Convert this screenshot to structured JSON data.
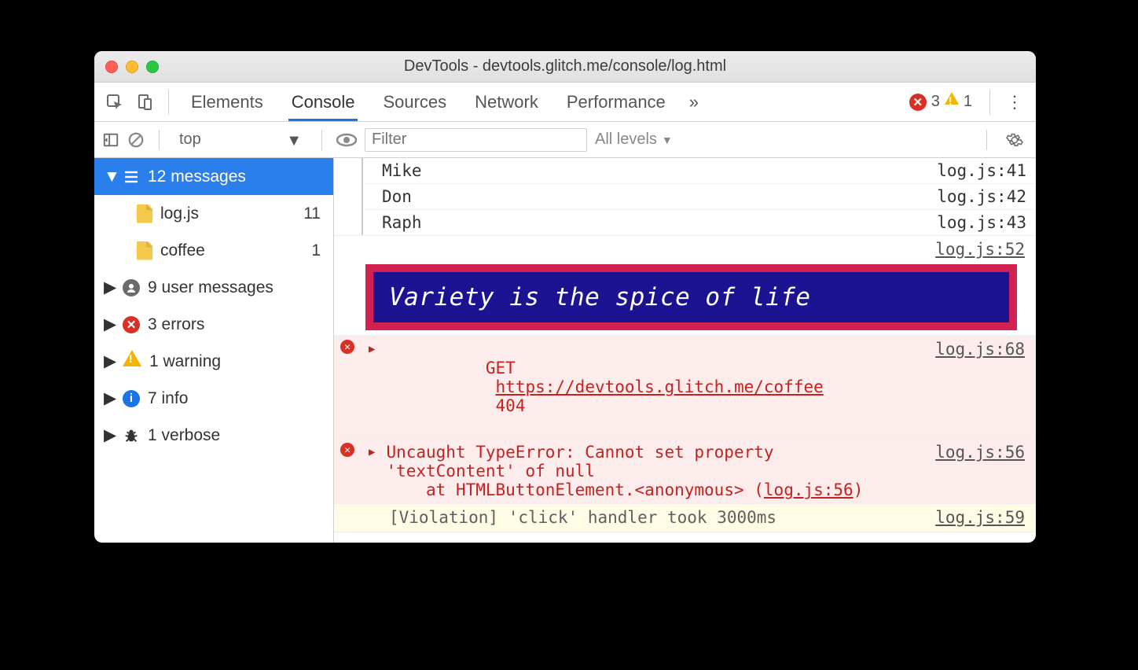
{
  "window": {
    "title": "DevTools - devtools.glitch.me/console/log.html"
  },
  "tabs": {
    "items": [
      "Elements",
      "Console",
      "Sources",
      "Network",
      "Performance"
    ],
    "active_index": 1,
    "overflow_glyph": "»"
  },
  "status_badges": {
    "errors": "3",
    "warnings": "1"
  },
  "toolbar": {
    "context": "top",
    "filter_placeholder": "Filter",
    "levels_label": "All levels"
  },
  "sidebar": {
    "messages": {
      "label": "12 messages"
    },
    "files": [
      {
        "name": "log.js",
        "count": "11"
      },
      {
        "name": "coffee",
        "count": "1"
      }
    ],
    "groups": [
      {
        "key": "user",
        "label": "9 user messages"
      },
      {
        "key": "errors",
        "label": "3 errors"
      },
      {
        "key": "warnings",
        "label": "1 warning"
      },
      {
        "key": "info",
        "label": "7 info"
      },
      {
        "key": "verbose",
        "label": "1 verbose"
      }
    ]
  },
  "logs": {
    "tree_items": [
      {
        "name": "Mike",
        "src": "log.js:41"
      },
      {
        "name": "Don",
        "src": "log.js:42"
      },
      {
        "name": "Raph",
        "src": "log.js:43"
      }
    ],
    "banner_src": "log.js:52",
    "banner_text": "Variety is the spice of life",
    "get_error": {
      "method": "GET",
      "url": "https://devtools.glitch.me/coffee",
      "status": "404",
      "src": "log.js:68"
    },
    "type_error": {
      "line1": "Uncaught TypeError: Cannot set property",
      "line2": "'textContent' of null",
      "stack_prefix": "    at HTMLButtonElement.",
      "stack_anon": "<anonymous>",
      "stack_open": " (",
      "stack_link": "log.js:56",
      "stack_close": ")",
      "src": "log.js:56"
    },
    "violation": {
      "text": "[Violation] 'click' handler took 3000ms",
      "src": "log.js:59"
    },
    "prompt": "›"
  }
}
